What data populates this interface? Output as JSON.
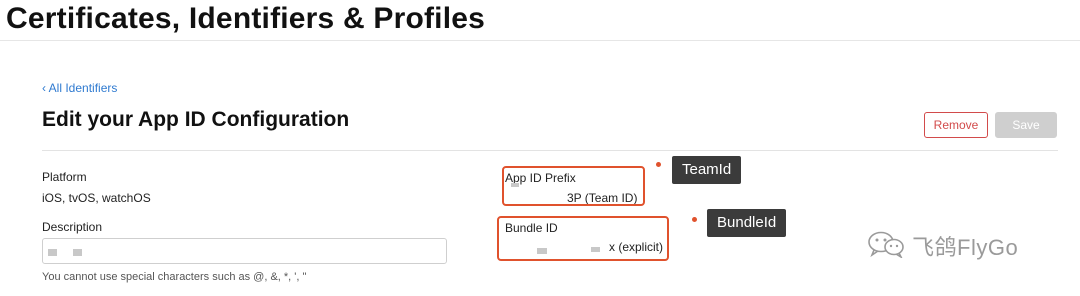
{
  "header": {
    "title": "Certificates, Identifiers & Profiles"
  },
  "nav": {
    "back_link": "‹ All Identifiers"
  },
  "main": {
    "section_title": "Edit your App ID Configuration",
    "actions": {
      "remove_label": "Remove",
      "save_label": "Save"
    },
    "platform": {
      "label": "Platform",
      "value": "iOS, tvOS, watchOS"
    },
    "description": {
      "label": "Description",
      "hint": "You cannot use special characters such as @, &, *, ', \""
    },
    "app_id_prefix": {
      "label": "App ID Prefix",
      "value": "3P (Team ID)"
    },
    "bundle_id": {
      "label": "Bundle ID",
      "value": "x (explicit)"
    }
  },
  "annotations": {
    "team_id_tag": "TeamId",
    "bundle_id_tag": "BundleId",
    "highlight_color": "#e0522d"
  },
  "watermark": {
    "text": "飞鸽FlyGo",
    "icon": "wechat-icon"
  }
}
